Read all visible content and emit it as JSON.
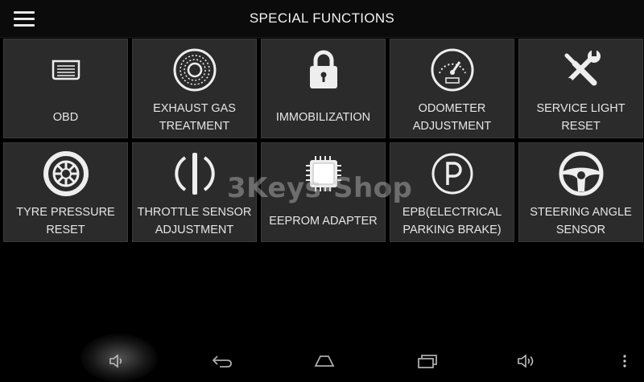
{
  "header": {
    "title": "SPECIAL FUNCTIONS"
  },
  "tiles": [
    {
      "label": "OBD",
      "icon": "obd-connector-icon"
    },
    {
      "label": "EXHAUST GAS\nTREATMENT",
      "icon": "particulate-filter-icon"
    },
    {
      "label": "IMMOBILIZATION",
      "icon": "padlock-icon"
    },
    {
      "label": "ODOMETER\nADJUSTMENT",
      "icon": "speedometer-icon"
    },
    {
      "label": "SERVICE LIGHT\nRESET",
      "icon": "wrench-screwdriver-icon"
    },
    {
      "label": "TYRE PRESSURE\nRESET",
      "icon": "tyre-icon"
    },
    {
      "label": "THROTTLE SENSOR\nADJUSTMENT",
      "icon": "throttle-icon"
    },
    {
      "label": "EEPROM ADAPTER",
      "icon": "chip-icon"
    },
    {
      "label": "EPB(ELECTRICAL\nPARKING BRAKE)",
      "icon": "parking-brake-icon"
    },
    {
      "label": "STEERING ANGLE\nSENSOR",
      "icon": "steering-wheel-icon"
    }
  ],
  "watermark": "3Keys-Shop",
  "navbar": {
    "icons": [
      "volume-down-icon",
      "back-icon",
      "home-icon",
      "recent-apps-icon",
      "volume-up-icon",
      "overflow-menu-icon"
    ]
  }
}
